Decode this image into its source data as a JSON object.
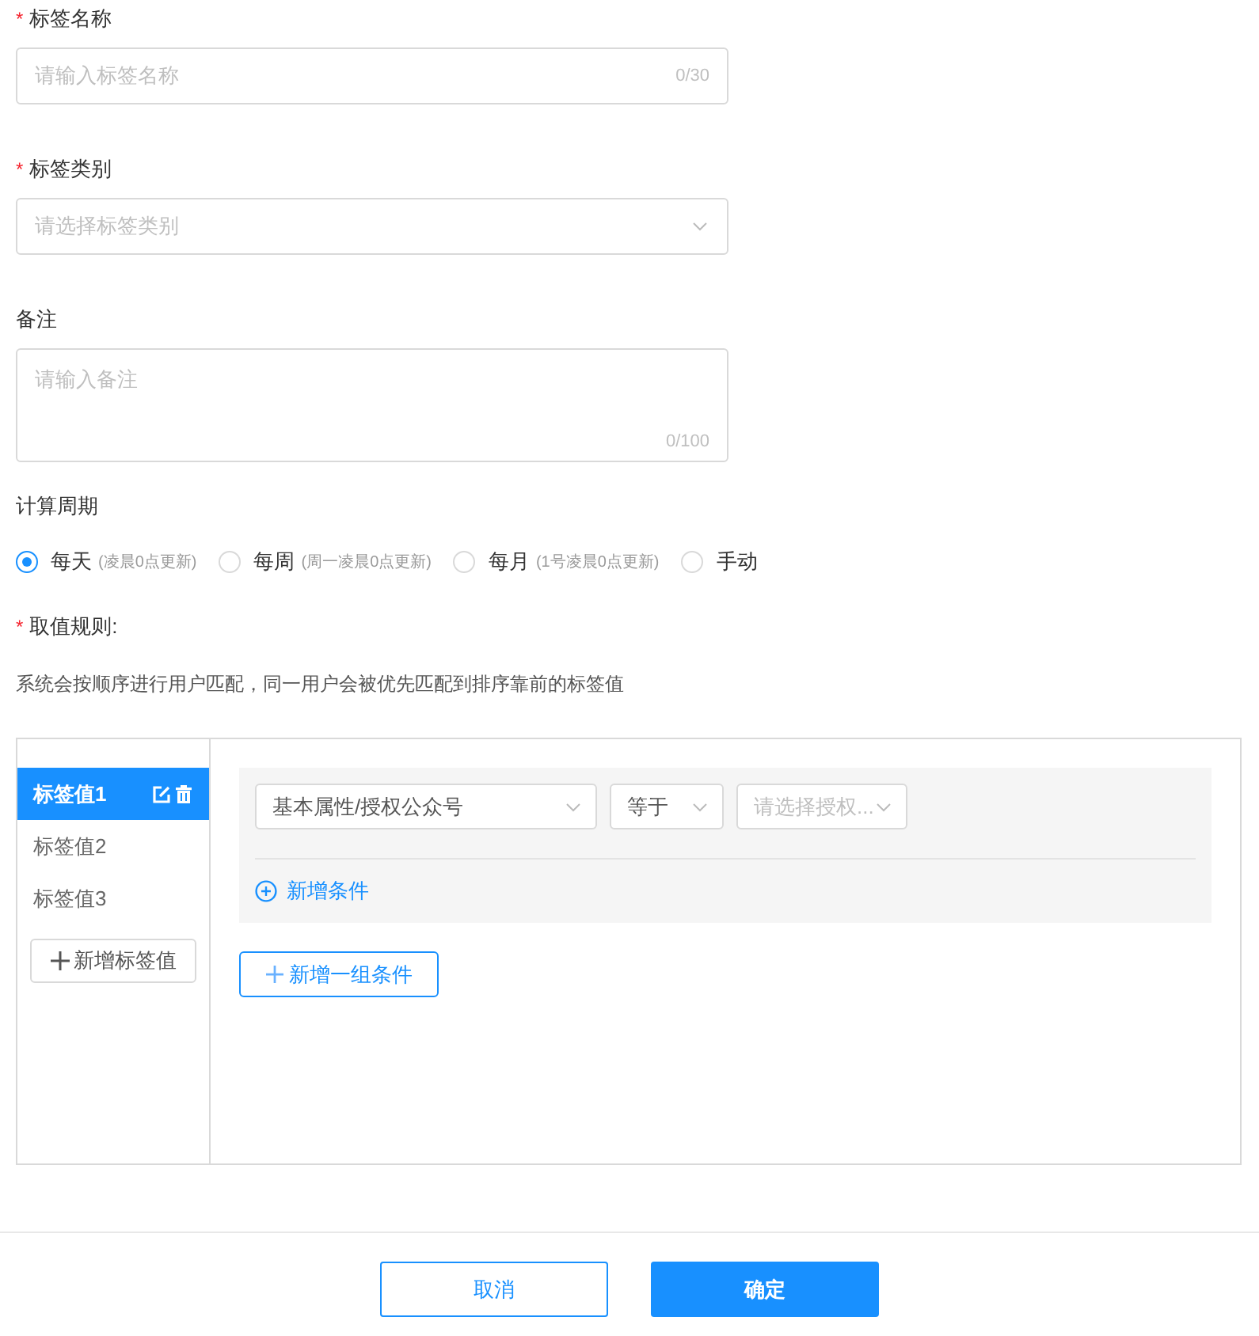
{
  "fields": [
    {
      "kind": "input",
      "label": "标签名称",
      "required_mark": "*",
      "placeholder": "请输入标签名称",
      "counter": "0/30"
    },
    {
      "kind": "select",
      "label": "标签类别",
      "required_mark": "*",
      "placeholder": "请选择标签类别"
    },
    {
      "kind": "textarea",
      "label": "备注",
      "placeholder": "请输入备注",
      "counter": "0/100"
    }
  ],
  "period": {
    "label": "计算周期",
    "options": [
      {
        "label": "每天",
        "note": "(凌晨0点更新)",
        "selected": true
      },
      {
        "label": "每周",
        "note": "(周一凌晨0点更新)",
        "selected": false
      },
      {
        "label": "每月",
        "note": "(1号凌晨0点更新)",
        "selected": false
      },
      {
        "label": "手动",
        "selected": false
      }
    ]
  },
  "rules": {
    "label": "取值规则:",
    "required_mark": "*",
    "description": "系统会按顺序进行用户匹配，同一用户会被优先匹配到排序靠前的标签值",
    "tag_values": [
      {
        "label": "标签值1",
        "selected": true
      },
      {
        "label": "标签值2",
        "selected": false
      },
      {
        "label": "标签值3",
        "selected": false
      }
    ],
    "add_tag_value": "新增标签值",
    "condition": {
      "attribute": "基本属性/授权公众号",
      "operator": "等于",
      "value_placeholder": "请选择授权..."
    },
    "add_condition": "新增条件",
    "add_group": "新增一组条件"
  },
  "buttons": {
    "cancel": "取消",
    "confirm": "确定"
  }
}
